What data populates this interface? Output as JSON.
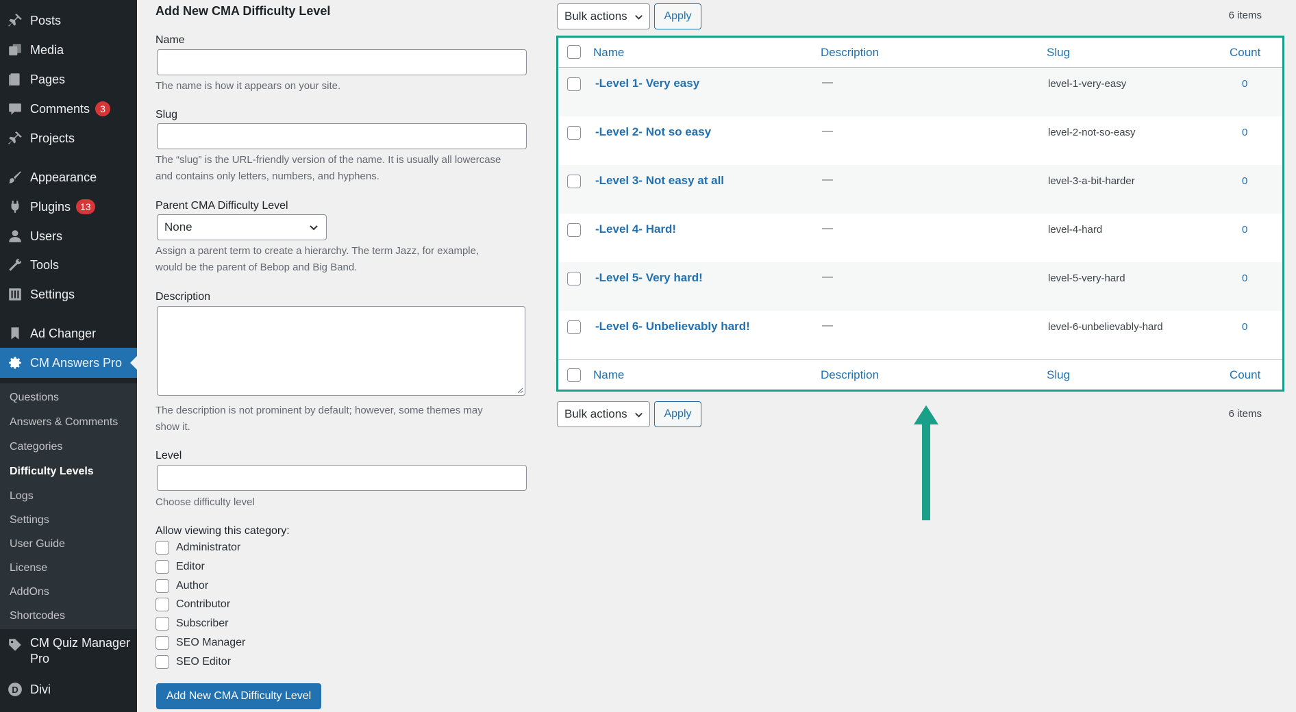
{
  "sidebar": {
    "menu": [
      {
        "label": "Posts",
        "icon": "pushpin-icon"
      },
      {
        "label": "Media",
        "icon": "media-icon"
      },
      {
        "label": "Pages",
        "icon": "pages-icon"
      },
      {
        "label": "Comments",
        "icon": "comment-icon",
        "badge": "3"
      },
      {
        "label": "Projects",
        "icon": "pushpin-icon"
      },
      {
        "label": "Appearance",
        "icon": "paintbrush-icon"
      },
      {
        "label": "Plugins",
        "icon": "plugin-icon",
        "badge": "13"
      },
      {
        "label": "Users",
        "icon": "user-icon"
      },
      {
        "label": "Tools",
        "icon": "wrench-icon"
      },
      {
        "label": "Settings",
        "icon": "settings-sliders-icon"
      },
      {
        "label": "Ad Changer",
        "icon": "bookmark-icon"
      },
      {
        "label": "CM Answers Pro",
        "icon": "gear-icon",
        "active": true
      }
    ],
    "submenu": [
      {
        "label": "Questions"
      },
      {
        "label": "Answers & Comments"
      },
      {
        "label": "Categories"
      },
      {
        "label": "Difficulty Levels",
        "current": true
      },
      {
        "label": "Logs"
      },
      {
        "label": "Settings"
      },
      {
        "label": "User Guide"
      },
      {
        "label": "License"
      },
      {
        "label": "AddOns"
      },
      {
        "label": "Shortcodes"
      }
    ],
    "bottom": [
      {
        "label_line1": "CM Quiz Manager",
        "label_line2": "Pro",
        "icon": "tag-icon"
      },
      {
        "label": "Divi",
        "icon": "divi-icon"
      }
    ]
  },
  "form": {
    "title": "Add New CMA Difficulty Level",
    "name_label": "Name",
    "name_value": "",
    "name_help": "The name is how it appears on your site.",
    "slug_label": "Slug",
    "slug_value": "",
    "slug_help_line1": "The “slug” is the URL-friendly version of the name. It is usually all lowercase",
    "slug_help_line2": "and contains only letters, numbers, and hyphens.",
    "parent_label": "Parent CMA Difficulty Level",
    "parent_value": "None",
    "parent_help_line1": "Assign a parent term to create a hierarchy. The term Jazz, for example,",
    "parent_help_line2": "would be the parent of Bebop and Big Band.",
    "description_label": "Description",
    "description_help_line1": "The description is not prominent by default; however, some themes may",
    "description_help_line2": "show it.",
    "level_label": "Level",
    "level_value": "",
    "level_help": "Choose difficulty level",
    "roles_label": "Allow viewing this category:",
    "roles": [
      "Administrator",
      "Editor",
      "Author",
      "Contributor",
      "Subscriber",
      "SEO Manager",
      "SEO Editor"
    ],
    "submit_label": "Add New CMA Difficulty Level"
  },
  "table": {
    "bulk_actions": "Bulk actions",
    "apply": "Apply",
    "items_count": "6 items",
    "columns": {
      "name": "Name",
      "description": "Description",
      "slug": "Slug",
      "count": "Count"
    },
    "rows": [
      {
        "name": "-Level 1- Very easy",
        "description": "—",
        "slug": "level-1-very-easy",
        "count": "0"
      },
      {
        "name": "-Level 2- Not so easy",
        "description": "—",
        "slug": "level-2-not-so-easy",
        "count": "0"
      },
      {
        "name": "-Level 3- Not easy at all",
        "description": "—",
        "slug": "level-3-a-bit-harder",
        "count": "0"
      },
      {
        "name": "-Level 4- Hard!",
        "description": "—",
        "slug": "level-4-hard",
        "count": "0"
      },
      {
        "name": "-Level 5- Very hard!",
        "description": "—",
        "slug": "level-5-very-hard",
        "count": "0"
      },
      {
        "name": "-Level 6- Unbelievably hard!",
        "description": "—",
        "slug": "level-6-unbelievably-hard",
        "count": "0"
      }
    ]
  },
  "colors": {
    "sidebar_bg": "#1d2327",
    "submenu_bg": "#2c3338",
    "accent_blue": "#2271b1",
    "highlight_teal": "#1aa089",
    "badge_red": "#d63638"
  }
}
